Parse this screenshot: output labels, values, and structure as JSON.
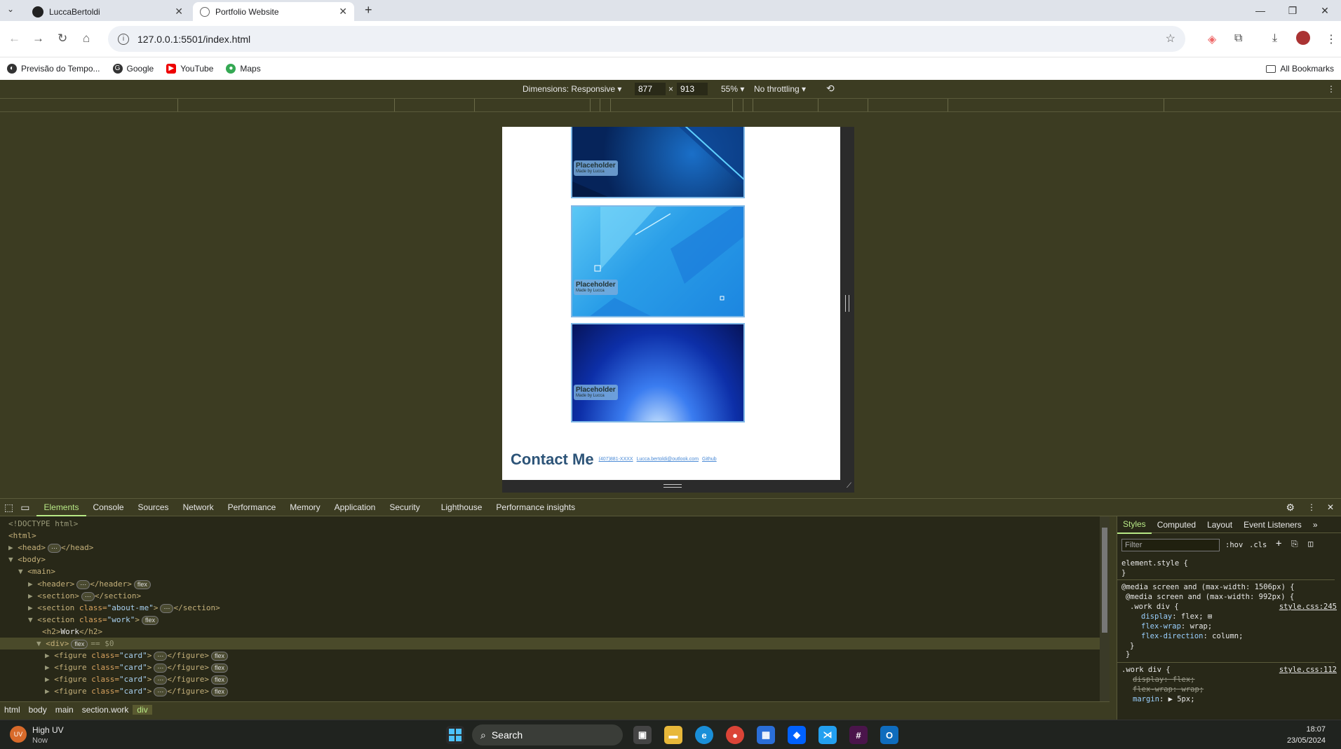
{
  "browser": {
    "tabs": [
      {
        "title": "LuccaBertoldi"
      },
      {
        "title": "Portfolio Website"
      }
    ],
    "url": "127.0.0.1:5501/index.html",
    "bookmarks": [
      "Previsão do Tempo...",
      "Google",
      "YouTube",
      "Maps"
    ],
    "all_bookmarks": "All Bookmarks"
  },
  "device_toolbar": {
    "dimensions": "Dimensions: Responsive",
    "width": "877",
    "times": "×",
    "height": "913",
    "zoom": "55%",
    "throttling": "No throttling"
  },
  "page": {
    "cards": [
      {
        "title": "Placeholder",
        "subtitle": "Made by Lucca"
      },
      {
        "title": "Placeholder",
        "subtitle": "Made by Lucca"
      },
      {
        "title": "Placeholder",
        "subtitle": "Made by Lucca"
      }
    ],
    "contact_heading": "Contact Me",
    "contact_links": [
      "(407)881-XXXX",
      "Lucca.bertoldi@outlook.com",
      "Github"
    ]
  },
  "devtools": {
    "tabs": [
      "Elements",
      "Console",
      "Sources",
      "Network",
      "Performance",
      "Memory",
      "Application",
      "Security",
      "Lighthouse",
      "Performance insights"
    ],
    "active_tab": "Elements",
    "elements": {
      "doctype": "<!DOCTYPE html>",
      "html": "<html>",
      "head": "<head>",
      "head_close": "</head>",
      "body": "<body>",
      "main": "<main>",
      "header": "<header>",
      "header_close": "</header>",
      "section": "<section>",
      "section_close": "</section>",
      "section_about_open": "<section ",
      "about_attr": "class=",
      "about_val": "\"about-me\"",
      "section_work_open": "<section ",
      "work_attr": "class=",
      "work_val": "\"work\"",
      "h2_open": "<h2>",
      "h2_text": "Work",
      "h2_close": "</h2>",
      "div_open": "<div>",
      "selected_marker": "== $0",
      "figure_open": "<figure ",
      "figure_attr": "class=",
      "figure_val": "\"card\"",
      "figure_close": "</figure>",
      "flex_pill": "flex"
    },
    "styles_tabs": [
      "Styles",
      "Computed",
      "Layout",
      "Event Listeners"
    ],
    "filter_placeholder": "Filter",
    "hov": ":hov",
    "cls": ".cls",
    "styles": {
      "element_style": "element.style {",
      "close": "}",
      "media1": "@media screen and (max-width: 1506px) {",
      "media2": "@media screen and (max-width: 992px) {",
      "rule1_selector": ".work div {",
      "rule1_link": "style.css:245",
      "p1": "display",
      "v1": "flex;",
      "p2": "flex-wrap",
      "v2": "wrap;",
      "p3": "flex-direction",
      "v3": "column;",
      "rule2_selector": ".work div {",
      "rule2_link": "style.css:112",
      "p4": "display: flex;",
      "p5": "flex-wrap: wrap;",
      "p6": "margin",
      "v6": "▶ 5px;"
    },
    "breadcrumbs": [
      "html",
      "body",
      "main",
      "section.work",
      "div"
    ]
  },
  "taskbar": {
    "weather_title": "High UV",
    "weather_sub": "Now",
    "search": "Search",
    "time": "18:07",
    "date": "23/05/2024"
  },
  "colors": {
    "devtools_bg": "#3c3c22",
    "contact_heading": "#2d5478",
    "accent": "#b8e986"
  }
}
